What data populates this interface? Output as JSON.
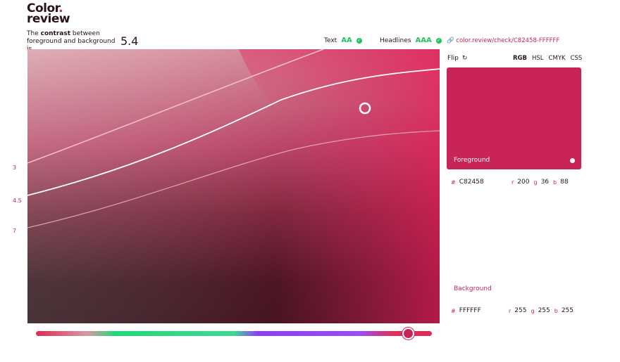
{
  "logo": {
    "line1": "Color",
    "dot": ".",
    "line2": "review"
  },
  "contrast": {
    "prefix": "The ",
    "bold": "contrast",
    "suffix": " between foreground and background is",
    "ratio": "5.4"
  },
  "text_badge": {
    "label": "Text",
    "rating": "AA"
  },
  "headlines_badge": {
    "label": "Headlines",
    "rating": "AAA"
  },
  "url": "color.review/check/C82458-FFFFFF",
  "y_labels": [
    "3",
    "4.5",
    "7"
  ],
  "panel": {
    "flip_label": "Flip",
    "modes": [
      "RGB",
      "HSL",
      "CMYK",
      "CSS"
    ],
    "active_mode": "RGB"
  },
  "foreground": {
    "label": "Foreground",
    "hex": "C82458",
    "r": "200",
    "g": "36",
    "b": "88",
    "color": "#c82458"
  },
  "background": {
    "label": "Background",
    "hex": "FFFFFF",
    "r": "255",
    "g": "255",
    "b": "255",
    "color": "#ffffff"
  },
  "hue_slider": {
    "value": 0.94
  }
}
